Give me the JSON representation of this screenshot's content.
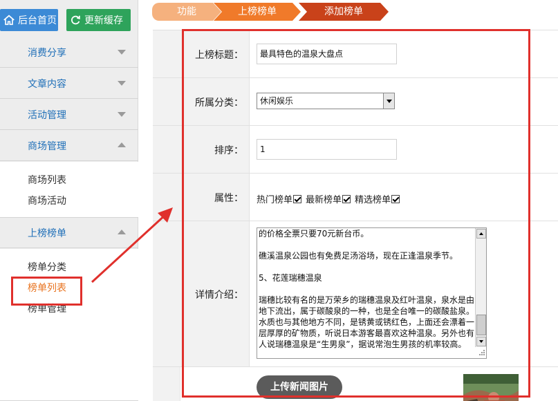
{
  "sidebar": {
    "home_label": "后台首页",
    "refresh_label": "更新缓存",
    "menus": [
      {
        "label": "消费分享",
        "state": "collapsed"
      },
      {
        "label": "文章内容",
        "state": "collapsed"
      },
      {
        "label": "活动管理",
        "state": "collapsed"
      },
      {
        "label": "商场管理",
        "state": "expanded"
      },
      {
        "label": "上榜榜单",
        "state": "expanded"
      }
    ],
    "mall_sub": [
      "商场列表",
      "商场活动"
    ],
    "rank_sub": [
      "榜单分类",
      "榜单列表",
      "榜单管理"
    ],
    "active_color": "#e8731f"
  },
  "breadcrumb": [
    "功能",
    "上榜榜单",
    "添加榜单"
  ],
  "form": {
    "title_label": "上榜标题：",
    "title_value": "最具特色的温泉大盘点",
    "category_label": "所属分类：",
    "category_value": "休闲娱乐",
    "sort_label": "排序：",
    "sort_value": "1",
    "attr_label": "属性：",
    "attrs": [
      "热门榜单",
      "最新榜单",
      "精选榜单"
    ],
    "detail_label": "详情介绍：",
    "detail_text": "的价格全票只要70元新台币。\n\n礁溪温泉公园也有免费足汤浴场，现在正逢温泉季节。\n\n5、花莲瑞穗温泉\n\n瑞穗比较有名的是万荣乡的瑞穗温泉及红叶温泉，泉水是由地下流出，属于碳酸泉的一种，也是全台唯一的碳酸盐泉。水质也与其他地方不同，是锈黄或锈红色，上面还会漂着一层厚厚的矿物质，听说日本游客最喜欢这种温泉。另外也有人说瑞穗温泉是“生男泉”，据说常泡生男孩的机率较高。",
    "upload_label": "上传新闻图片"
  },
  "colors": {
    "annotation": "#e0302c",
    "link_blue": "#1f6fb8",
    "home_btn": "#3c8ad6",
    "refresh_btn": "#2ea35b"
  },
  "icons": {
    "home": "home-icon",
    "refresh": "refresh-icon",
    "collapse": "chevron-down-icon",
    "expand": "chevron-up-icon"
  }
}
